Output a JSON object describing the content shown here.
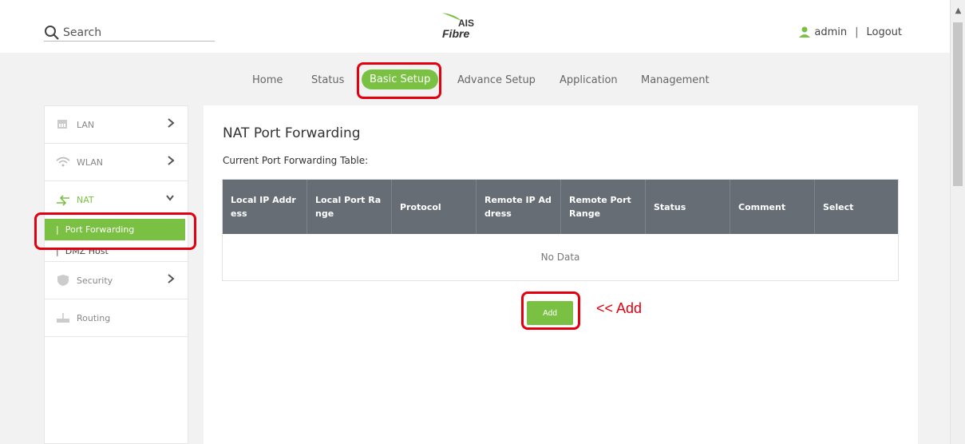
{
  "header": {
    "search_placeholder": "Search",
    "logo_text": "AIS",
    "logo_sub": "Fibre",
    "user_name": "admin",
    "separator": "|",
    "logout_label": "Logout"
  },
  "nav": {
    "items": [
      {
        "label": "Home"
      },
      {
        "label": "Status"
      },
      {
        "label": "Basic Setup",
        "active": true
      },
      {
        "label": "Advance Setup"
      },
      {
        "label": "Application"
      },
      {
        "label": "Management"
      }
    ]
  },
  "sidebar": {
    "lan": "LAN",
    "wlan": "WLAN",
    "nat": "NAT",
    "port_forwarding": "Port Forwarding",
    "dmz_host": "DMZ Host",
    "security": "Security",
    "routing": "Routing",
    "bar": "|"
  },
  "content": {
    "title": "NAT Port Forwarding",
    "table_title": "Current Port Forwarding Table:",
    "columns": [
      "Local IP Addr ess",
      "Local Port Ra nge",
      "Protocol",
      "Remote IP Ad dress",
      "Remote Port Range",
      "Status",
      "Comment",
      "Select"
    ],
    "empty_text": "No Data",
    "add_label": "Add"
  },
  "annotation": {
    "add_note": "<< Add",
    "color": "#e3000f"
  },
  "colors": {
    "accent": "#7ac143",
    "table_header": "#666d75"
  }
}
